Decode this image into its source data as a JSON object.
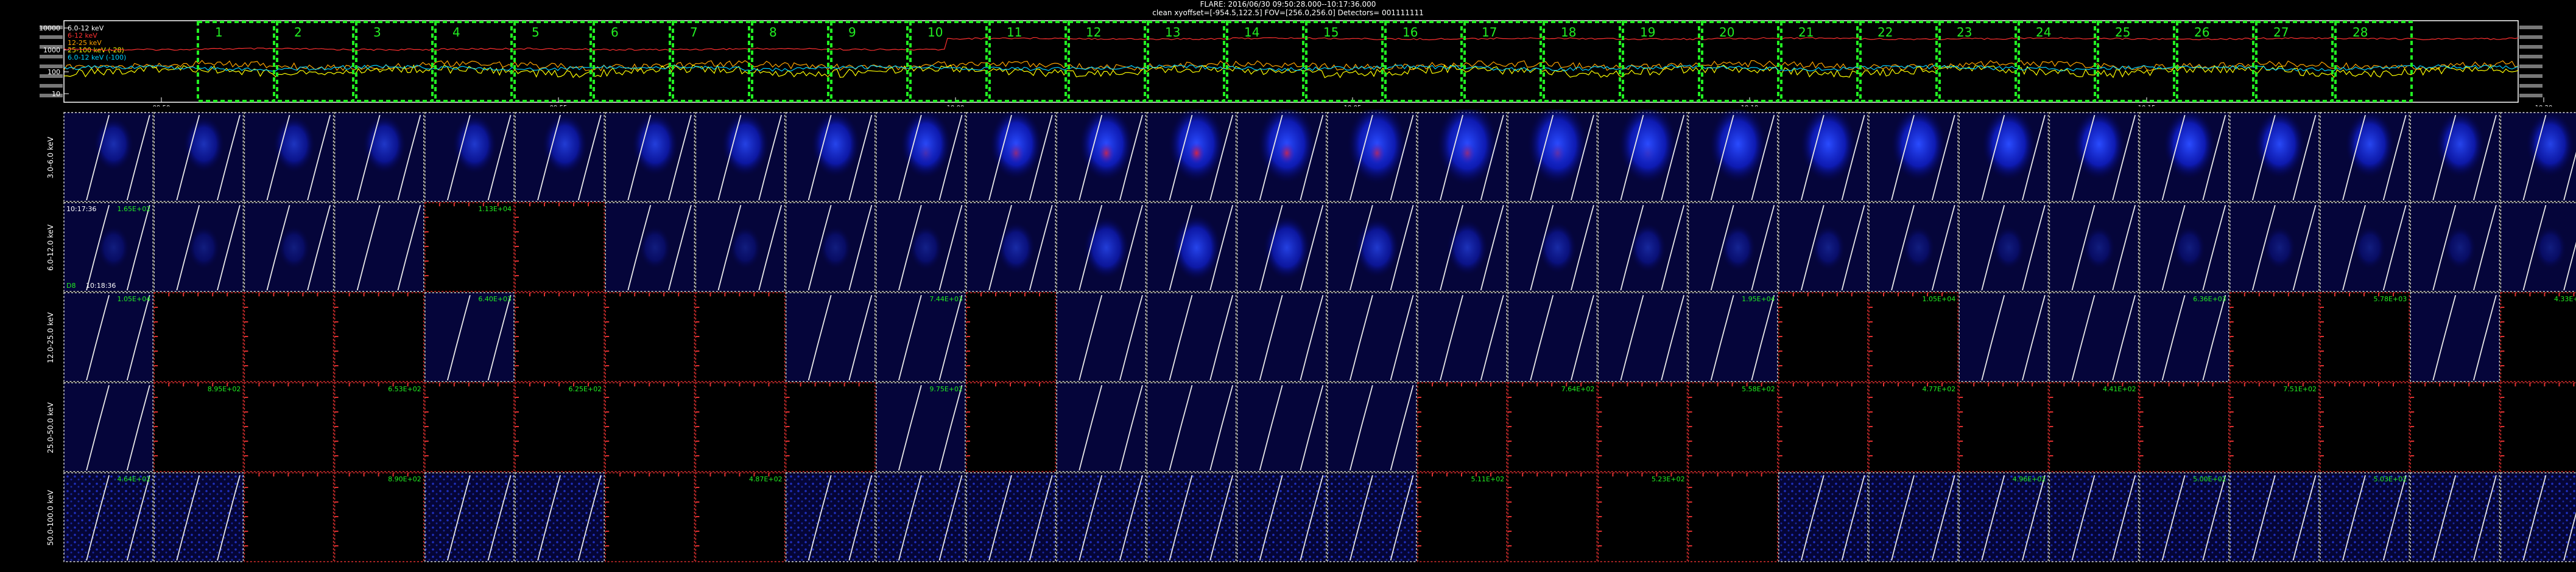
{
  "header": {
    "line1": "FLARE: 2016/06/30 09:50:28.000--10:17:36.000",
    "line2": "clean    xyoffset=[-954.5,122.5]    FOV=[256.0,256.0]    Detectors= 001111111"
  },
  "chart_data": {
    "type": "line",
    "lightcurve": {
      "y_ticks": [
        "10000",
        "1000",
        "100",
        "10"
      ],
      "x_ticks": [
        "09:50",
        "09:55",
        "10:00",
        "10:05",
        "10:10",
        "10:15",
        "10:20"
      ],
      "legend": [
        {
          "label": "6.0-12 keV",
          "color": "#ffffff"
        },
        {
          "label": "6-12 keV",
          "color": "#ff3030"
        },
        {
          "label": "12-25 keV",
          "color": "#ffa500"
        },
        {
          "label": "25-100 keV (-28)",
          "color": "#ffff00"
        },
        {
          "label": "6.0-12 keV (-100)",
          "color": "#00d0ff"
        }
      ],
      "intervals": [
        "1",
        "2",
        "3",
        "4",
        "5",
        "6",
        "7",
        "8",
        "9",
        "10",
        "11",
        "12",
        "13",
        "14",
        "15",
        "16",
        "17",
        "18",
        "19",
        "20",
        "21",
        "22",
        "23",
        "24",
        "25",
        "26",
        "27",
        "28"
      ],
      "series": [
        {
          "color": "#ff3030",
          "level": 0.35,
          "noise": 0.02,
          "rise_at": 0.36,
          "rise_to": 0.22
        },
        {
          "color": "#ffa500",
          "level": 0.55,
          "noise": 0.08,
          "rise_at": 0.5,
          "rise_to": 0.55
        },
        {
          "color": "#ffff00",
          "level": 0.62,
          "noise": 0.1,
          "rise_at": 0.5,
          "rise_to": 0.62
        },
        {
          "color": "#00d0ff",
          "level": 0.58,
          "noise": 0.05,
          "rise_at": 0.5,
          "rise_to": 0.58
        }
      ]
    },
    "image_grid": {
      "rows": [
        {
          "label": "3.0-6.0 keV",
          "empty": [],
          "peaks": [
            0.3,
            0.35,
            0.38,
            0.42,
            0.45,
            0.48,
            0.52,
            0.56,
            0.6,
            0.66,
            0.72,
            0.78,
            0.85,
            0.9,
            0.95,
            1.0,
            0.98,
            0.92,
            0.88,
            0.84,
            0.8,
            0.76,
            0.72,
            0.7,
            0.66,
            0.62,
            0.6,
            0.58
          ],
          "core": [
            0,
            0,
            0,
            0,
            0,
            0,
            0,
            0,
            0,
            0.2,
            0.5,
            0.7,
            0.8,
            0.7,
            0.6,
            0.5,
            0.3,
            0.1,
            0,
            0,
            0,
            0,
            0,
            0,
            0,
            0,
            0,
            0
          ]
        },
        {
          "label": "6.0-12.0 keV",
          "empty": [
            4,
            5
          ],
          "peaks": [
            0.05,
            0.05,
            0.05,
            0,
            0,
            0.05,
            0.05,
            0.05,
            0.05,
            0.1,
            0.25,
            0.5,
            0.6,
            0.55,
            0.45,
            0.35,
            0.25,
            0.2,
            0.15,
            0.1,
            0.05,
            0.05,
            0.05,
            0.05,
            0.05,
            0.05,
            0.05,
            0.05
          ],
          "core": []
        },
        {
          "label": "12.0-25.0 keV",
          "empty": [
            1,
            2,
            3,
            5,
            6,
            7,
            10,
            19,
            20,
            24,
            25,
            27
          ],
          "peaks": [],
          "core": []
        },
        {
          "label": "25.0-50.0 keV",
          "empty": [
            1,
            2,
            3,
            4,
            5,
            6,
            7,
            8,
            10,
            15,
            16,
            17,
            18,
            19,
            20,
            21,
            22,
            23,
            24,
            25,
            26,
            27
          ],
          "peaks": [],
          "core": []
        },
        {
          "label": "50.0-100.0 keV",
          "empty": [
            2,
            3,
            6,
            7,
            15,
            16,
            17,
            18
          ],
          "peaks": [],
          "core": []
        }
      ],
      "annotations": [
        {
          "row": 1,
          "col": 0,
          "text": "10:17:36",
          "pos": "tl",
          "color": "#ffffff"
        },
        {
          "row": 1,
          "col": 0,
          "text": "10:18:36",
          "pos": "bl",
          "color": "#ffffff"
        },
        {
          "row": 1,
          "col": 0,
          "text": "1.65E+02",
          "pos": "tr",
          "color": "#22ee22"
        },
        {
          "row": 1,
          "col": 0,
          "text": "D8",
          "pos": "bll",
          "color": "#22ee22"
        },
        {
          "row": 1,
          "col": 4,
          "text": "1.13E+04",
          "pos": "tr",
          "color": "#22ee22"
        },
        {
          "row": 2,
          "col": 0,
          "text": "1.05E+04",
          "pos": "tr",
          "color": "#22ee22"
        },
        {
          "row": 2,
          "col": 4,
          "text": "6.40E+03",
          "pos": "tr",
          "color": "#22ee22"
        },
        {
          "row": 2,
          "col": 9,
          "text": "7.44E+03",
          "pos": "tr",
          "color": "#22ee22"
        },
        {
          "row": 2,
          "col": 18,
          "text": "1.95E+04",
          "pos": "tr",
          "color": "#22ee22"
        },
        {
          "row": 2,
          "col": 20,
          "text": "1.05E+04",
          "pos": "tr",
          "color": "#22ee22"
        },
        {
          "row": 2,
          "col": 23,
          "text": "6.36E+03",
          "pos": "tr",
          "color": "#22ee22"
        },
        {
          "row": 2,
          "col": 25,
          "text": "5.78E+03",
          "pos": "tr",
          "color": "#22ee22"
        },
        {
          "row": 2,
          "col": 27,
          "text": "4.33E+03",
          "pos": "tr",
          "color": "#22ee22"
        },
        {
          "row": 3,
          "col": 1,
          "text": "8.95E+02",
          "pos": "tr",
          "color": "#22ee22"
        },
        {
          "row": 3,
          "col": 3,
          "text": "6.53E+02",
          "pos": "tr",
          "color": "#22ee22"
        },
        {
          "row": 3,
          "col": 5,
          "text": "6.25E+02",
          "pos": "tr",
          "color": "#22ee22"
        },
        {
          "row": 3,
          "col": 9,
          "text": "9.75E+02",
          "pos": "tr",
          "color": "#22ee22"
        },
        {
          "row": 3,
          "col": 16,
          "text": "7.64E+02",
          "pos": "tr",
          "color": "#22ee22"
        },
        {
          "row": 3,
          "col": 18,
          "text": "5.58E+02",
          "pos": "tr",
          "color": "#22ee22"
        },
        {
          "row": 3,
          "col": 20,
          "text": "4.77E+02",
          "pos": "tr",
          "color": "#22ee22"
        },
        {
          "row": 3,
          "col": 22,
          "text": "4.41E+02",
          "pos": "tr",
          "color": "#22ee22"
        },
        {
          "row": 3,
          "col": 24,
          "text": "7.51E+02",
          "pos": "tr",
          "color": "#22ee22"
        },
        {
          "row": 4,
          "col": 0,
          "text": "4.64E+02",
          "pos": "tr",
          "color": "#22ee22"
        },
        {
          "row": 4,
          "col": 3,
          "text": "8.90E+02",
          "pos": "tr",
          "color": "#22ee22"
        },
        {
          "row": 4,
          "col": 7,
          "text": "4.87E+02",
          "pos": "tr",
          "color": "#22ee22"
        },
        {
          "row": 4,
          "col": 15,
          "text": "5.11E+02",
          "pos": "tr",
          "color": "#22ee22"
        },
        {
          "row": 4,
          "col": 17,
          "text": "5.23E+02",
          "pos": "tr",
          "color": "#22ee22"
        },
        {
          "row": 4,
          "col": 21,
          "text": "4.96E+02",
          "pos": "tr",
          "color": "#22ee22"
        },
        {
          "row": 4,
          "col": 23,
          "text": "5.00E+02",
          "pos": "tr",
          "color": "#22ee22"
        },
        {
          "row": 4,
          "col": 25,
          "text": "5.03E+02",
          "pos": "tr",
          "color": "#22ee22"
        }
      ]
    }
  }
}
